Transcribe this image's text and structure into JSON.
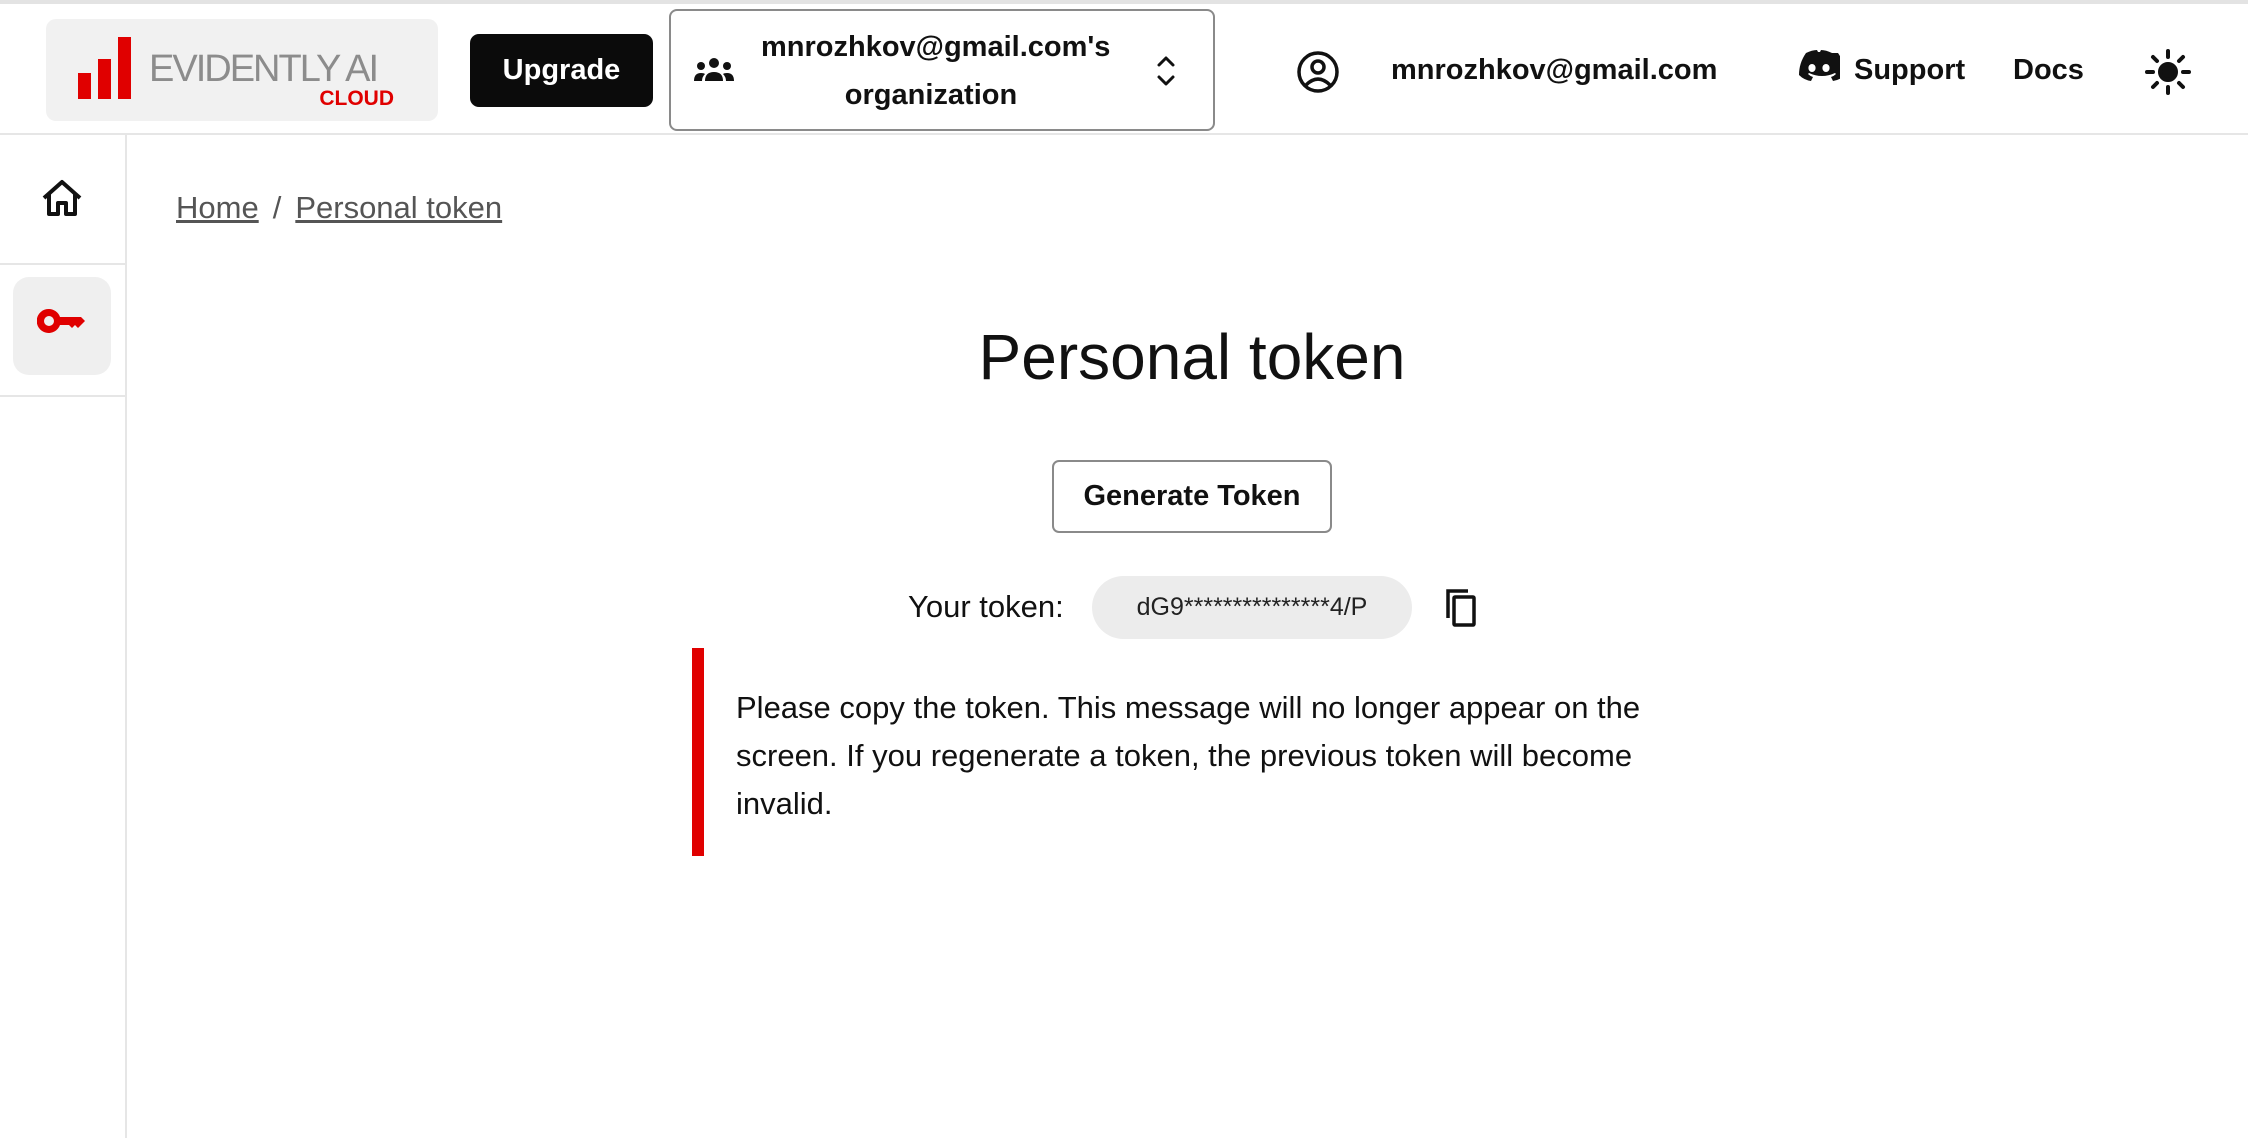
{
  "header": {
    "logo": {
      "brand": "EVIDENTLY AI",
      "sub": "CLOUD",
      "icon": "bar-chart-logo"
    },
    "upgrade_label": "Upgrade",
    "org_selector": {
      "label": "mnrozhkov@gmail.com's organization",
      "icon": "group-icon",
      "chevron": "unfold-icon"
    },
    "account": {
      "icon": "account-circle-icon",
      "email": "mnrozhkov@gmail.com"
    },
    "support_label": "Support",
    "support_icon": "discord-icon",
    "docs_label": "Docs",
    "theme_icon": "sun-icon"
  },
  "sidebar": {
    "items": [
      {
        "name": "home",
        "icon": "home-icon",
        "active": false
      },
      {
        "name": "token",
        "icon": "key-icon",
        "active": true
      }
    ]
  },
  "breadcrumb": {
    "items": [
      "Home",
      "Personal token"
    ],
    "separator": "/"
  },
  "main": {
    "title": "Personal token",
    "generate_label": "Generate Token",
    "token_label": "Your token:",
    "token_value": "dG9***************4/P",
    "copy_icon": "copy-icon",
    "notice": "Please copy the token. This message will no longer appear on the screen. If you regenerate a token, the previous token will become invalid."
  },
  "colors": {
    "accent": "#e00000",
    "dark_button": "#0b0b0b",
    "logo_grey": "#8c8c8c",
    "chip_bg": "#ececec"
  }
}
